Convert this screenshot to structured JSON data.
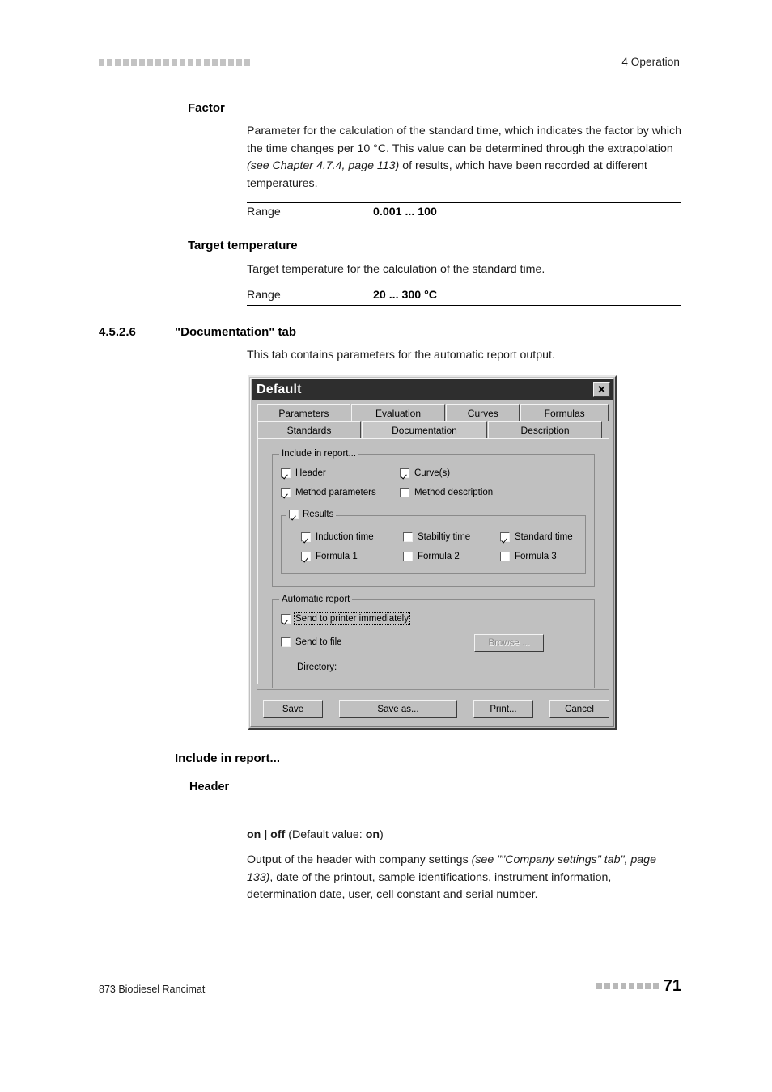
{
  "page": {
    "header_right": "4 Operation",
    "header_square_count": 19,
    "footer_left": "873 Biodiesel Rancimat",
    "footer_square_count": 8,
    "page_number": "71"
  },
  "sections": {
    "factor": {
      "heading": "Factor",
      "body_1": "Parameter for the calculation of the standard time, which indicates the factor by which the time changes per 10 °C. This value can be determined through the extrapolation ",
      "body_italic": "(see Chapter 4.7.4, page 113)",
      "body_2": " of results, which have been recorded at different temperatures.",
      "range_label": "Range",
      "range_value": "0.001 ... 100"
    },
    "target_temperature": {
      "heading": "Target temperature",
      "body": "Target temperature for the calculation of the standard time.",
      "range_label": "Range",
      "range_value": "20 ... 300 °C"
    },
    "documentation_tab": {
      "number": "4.5.2.6",
      "heading": "\"Documentation\" tab",
      "body": "This tab contains parameters for the automatic report output."
    },
    "include_in_report": {
      "heading": "Include in report...",
      "header": {
        "heading": "Header",
        "values_bold_1": "on | off",
        "values_rest": " (Default value: ",
        "values_bold_2": "on",
        "values_close": ")",
        "body_1": "Output of the header with company settings ",
        "body_italic": "(see \"\"Company settings\" tab\", page 133)",
        "body_2": ", date of the printout, sample identifications, instrument information, determination date, user, cell constant and serial number."
      }
    }
  },
  "dialog": {
    "title": "Default",
    "close_icon": "close-x-icon",
    "tabs_row1": [
      {
        "label": "Parameters",
        "selected": false
      },
      {
        "label": "Evaluation",
        "selected": false
      },
      {
        "label": "Curves",
        "selected": false
      },
      {
        "label": "Formulas",
        "selected": false
      }
    ],
    "tabs_row2": [
      {
        "label": "Standards",
        "selected": false
      },
      {
        "label": "Documentation",
        "selected": true
      },
      {
        "label": "Description",
        "selected": false
      }
    ],
    "include_group": {
      "title": "Include in report...",
      "checkboxes": [
        {
          "label": "Header",
          "checked": true
        },
        {
          "label": "Curve(s)",
          "checked": true
        },
        {
          "label": "Method parameters",
          "checked": true
        },
        {
          "label": "Method description",
          "checked": false
        }
      ],
      "results_group": {
        "title": "Results",
        "checked": true,
        "checkboxes": [
          {
            "label": "Induction time",
            "checked": true
          },
          {
            "label": "Stabiltiy time",
            "checked": false
          },
          {
            "label": "Standard time",
            "checked": true
          },
          {
            "label": "Formula 1",
            "checked": true
          },
          {
            "label": "Formula 2",
            "checked": false
          },
          {
            "label": "Formula 3",
            "checked": false
          }
        ]
      }
    },
    "automatic_group": {
      "title": "Automatic report",
      "send_printer": {
        "label": "Send to printer immediately",
        "checked": true,
        "focused": true
      },
      "send_file": {
        "label": "Send to file",
        "checked": false
      },
      "browse_button": {
        "label": "Browse ...",
        "disabled": true
      },
      "directory_label": "Directory:"
    },
    "buttons": [
      {
        "label": "Save"
      },
      {
        "label": "Save as..."
      },
      {
        "label": "Print..."
      },
      {
        "label": "Cancel"
      }
    ]
  }
}
